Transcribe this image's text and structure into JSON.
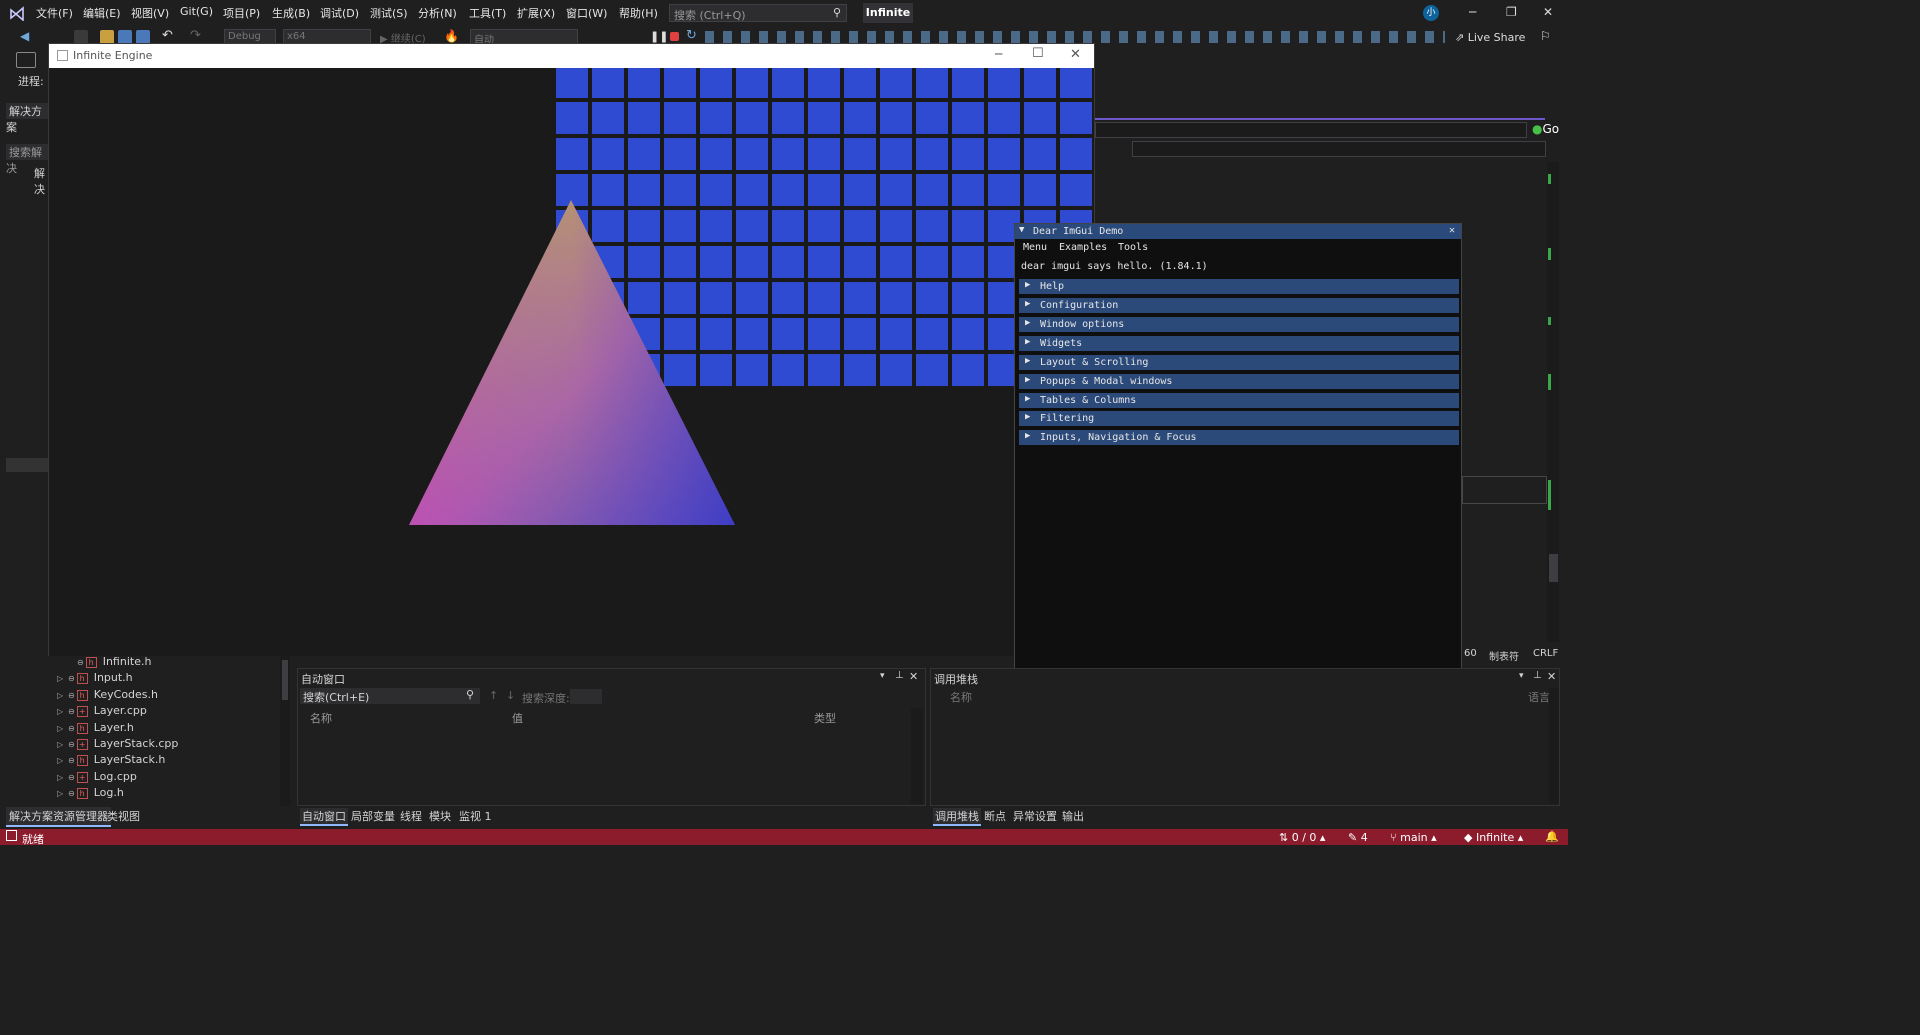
{
  "vs": {
    "menu": [
      "文件(F)",
      "编辑(E)",
      "视图(V)",
      "Git(G)",
      "项目(P)",
      "生成(B)",
      "调试(D)",
      "测试(S)",
      "分析(N)",
      "工具(T)",
      "扩展(X)",
      "窗口(W)",
      "帮助(H)"
    ],
    "search_placeholder": "搜索 (Ctrl+Q)",
    "solution_name": "Infinite",
    "avatar_initial": "小",
    "toolbar": {
      "config": "Debug",
      "platform": "x64",
      "continue_label": "继续(C)",
      "auto_label": "自动",
      "live_share": "Live Share"
    },
    "left": {
      "process_label": "进程:",
      "solution_explorer_title": "解决方案",
      "search_label": "搜索解决",
      "root_item": "解决"
    },
    "go_label": "Go",
    "editor_status": {
      "col": "60",
      "tabs": "制表符",
      "eol": "CRLF"
    }
  },
  "engine": {
    "title": "Infinite Engine",
    "colors": {
      "grid": "#2e4bd1",
      "triangle_top": "#c6c23a",
      "triangle_left": "#c33ac6",
      "triangle_right": "#3d3ec4"
    }
  },
  "imgui": {
    "title": "Dear ImGui Demo",
    "menu": [
      "Menu",
      "Examples",
      "Tools"
    ],
    "hello": "dear imgui says hello. (1.84.1)",
    "headers": [
      "Help",
      "Configuration",
      "Window options",
      "Widgets",
      "Layout & Scrolling",
      "Popups & Modal windows",
      "Tables & Columns",
      "Filtering",
      "Inputs, Navigation & Focus"
    ]
  },
  "solution_files": [
    {
      "name": "Infinite.h",
      "type": "h"
    },
    {
      "name": "Input.h",
      "type": "h"
    },
    {
      "name": "KeyCodes.h",
      "type": "h"
    },
    {
      "name": "Layer.cpp",
      "type": "cpp"
    },
    {
      "name": "Layer.h",
      "type": "h"
    },
    {
      "name": "LayerStack.cpp",
      "type": "cpp"
    },
    {
      "name": "LayerStack.h",
      "type": "h"
    },
    {
      "name": "Log.cpp",
      "type": "cpp"
    },
    {
      "name": "Log.h",
      "type": "h"
    }
  ],
  "left_tabs": [
    "解决方案资源管理器",
    "类视图"
  ],
  "autos": {
    "title": "自动窗口",
    "search": "搜索(Ctrl+E)",
    "depth_label": "搜索深度:",
    "columns": [
      "名称",
      "值",
      "类型"
    ],
    "tabs": [
      "自动窗口",
      "局部变量",
      "线程",
      "模块",
      "监视 1"
    ]
  },
  "callstack": {
    "title": "调用堆栈",
    "columns": [
      "名称",
      "语言"
    ],
    "tabs": [
      "调用堆栈",
      "断点",
      "异常设置",
      "输出"
    ]
  },
  "statusbar": {
    "ready": "就绪",
    "changes": "0 / 0",
    "pencil_count": "4",
    "branch": "main",
    "repo": "Infinite"
  }
}
